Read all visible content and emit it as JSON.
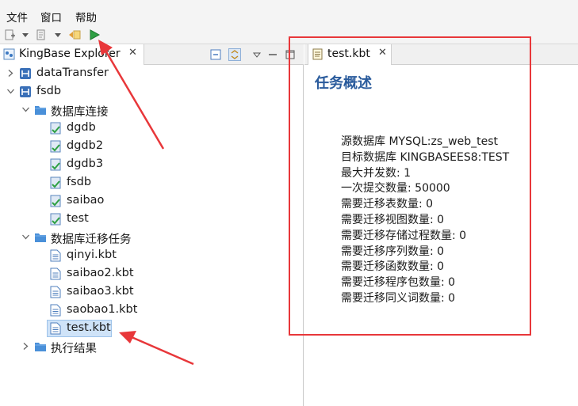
{
  "menubar": {
    "items": [
      "文件",
      "窗口",
      "帮助"
    ]
  },
  "explorer": {
    "tab_title": "KingBase Explorer",
    "tree": [
      {
        "label": "dataTransfer",
        "type": "connection",
        "expanded": false
      },
      {
        "label": "fsdb",
        "type": "connection",
        "expanded": true
      },
      {
        "label": "数据库连接",
        "type": "folder",
        "expanded": true
      },
      {
        "label": "dgdb",
        "type": "database"
      },
      {
        "label": "dgdb2",
        "type": "database"
      },
      {
        "label": "dgdb3",
        "type": "database"
      },
      {
        "label": "fsdb",
        "type": "database"
      },
      {
        "label": "saibao",
        "type": "database"
      },
      {
        "label": "test",
        "type": "database"
      },
      {
        "label": "数据库迁移任务",
        "type": "folder",
        "expanded": true
      },
      {
        "label": "qinyi.kbt",
        "type": "file"
      },
      {
        "label": "saibao2.kbt",
        "type": "file"
      },
      {
        "label": "saibao3.kbt",
        "type": "file"
      },
      {
        "label": "saobao1.kbt",
        "type": "file"
      },
      {
        "label": "test.kbt",
        "type": "file",
        "selected": true
      },
      {
        "label": "执行结果",
        "type": "folder",
        "expanded": false
      }
    ]
  },
  "editor": {
    "tab_title": "test.kbt",
    "heading": "任务概述",
    "stats": [
      "源数据库 MYSQL:zs_web_test",
      "目标数据库 KINGBASEES8:TEST",
      "最大并发数: 1",
      "一次提交数量: 50000",
      "需要迁移表数量: 0",
      "需要迁移视图数量: 0",
      "需要迁移存储过程数量: 0",
      "需要迁移序列数量: 0",
      "需要迁移函数数量: 0",
      "需要迁移程序包数量: 0",
      "需要迁移同义词数量: 0"
    ]
  },
  "colors": {
    "heading": "#2a5b9c",
    "annotation": "#e8373a",
    "selection": "#cfe3f8"
  }
}
